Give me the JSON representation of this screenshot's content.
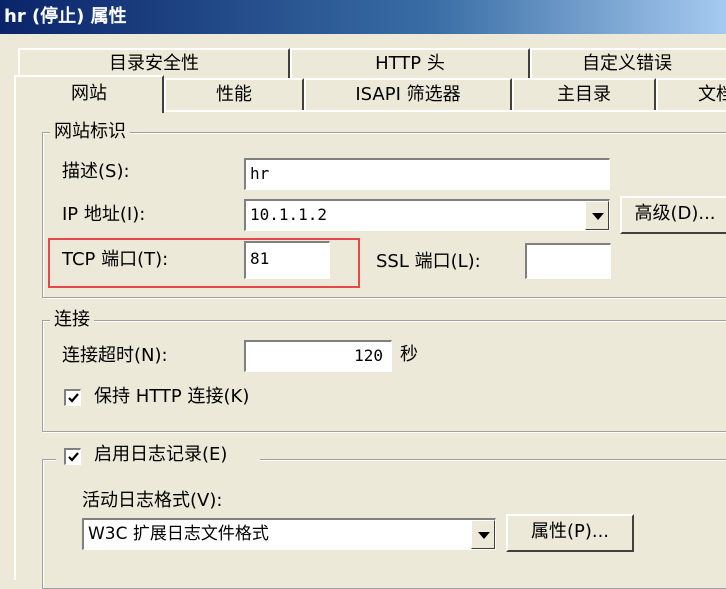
{
  "window": {
    "title": "hr (停止) 属性"
  },
  "tabs": {
    "row1": [
      {
        "label": "目录安全性"
      },
      {
        "label": "HTTP 头"
      },
      {
        "label": "自定义错误"
      }
    ],
    "row2": [
      {
        "label": "网站"
      },
      {
        "label": "性能"
      },
      {
        "label": "ISAPI 筛选器"
      },
      {
        "label": "主目录"
      },
      {
        "label": "文档"
      }
    ]
  },
  "site_id": {
    "legend": "网站标识",
    "description_label": "描述(S):",
    "description_value": "hr",
    "ip_label": "IP 地址(I):",
    "ip_value": "10.1.1.2",
    "advanced_button": "高级(D)...",
    "tcp_port_label": "TCP 端口(T):",
    "tcp_port_value": "81",
    "ssl_port_label": "SSL 端口(L):",
    "ssl_port_value": ""
  },
  "connections": {
    "legend": "连接",
    "timeout_label": "连接超时(N):",
    "timeout_value": "120",
    "timeout_unit": "秒",
    "keepalive_label": "保持 HTTP 连接(K)",
    "keepalive_checked": true
  },
  "logging": {
    "enable_label": "启用日志记录(E)",
    "enable_checked": true,
    "format_label": "活动日志格式(V):",
    "format_value": "W3C 扩展日志文件格式",
    "properties_button": "属性(P)..."
  },
  "colors": {
    "highlight": "#e8474c",
    "titlebar": "#0a246a",
    "face": "#ece9d8"
  }
}
